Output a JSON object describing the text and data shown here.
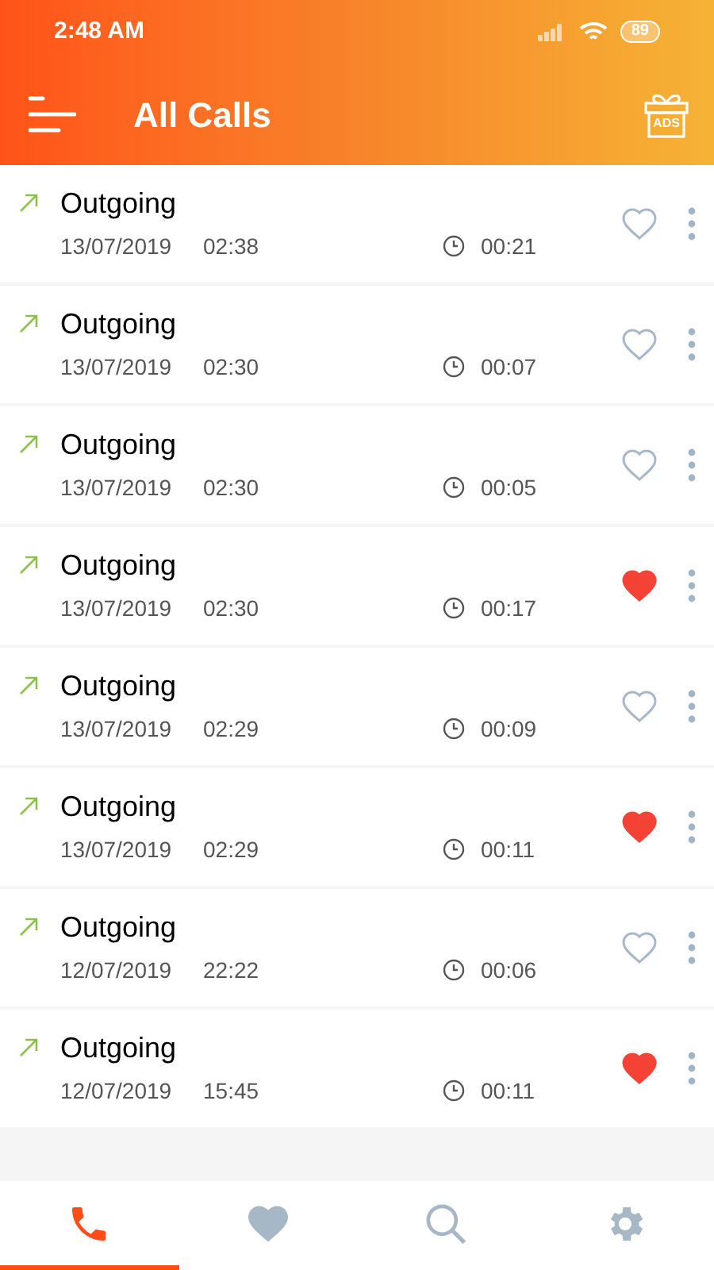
{
  "status_bar": {
    "time": "2:48 AM",
    "battery": "89"
  },
  "app_bar": {
    "title": "All Calls",
    "ads_label": "ADS"
  },
  "calls": [
    {
      "kind": "outgoing",
      "label": "Outgoing",
      "date": "13/07/2019",
      "time": "02:38",
      "duration": "00:21",
      "favorite": false
    },
    {
      "kind": "outgoing",
      "label": "Outgoing",
      "date": "13/07/2019",
      "time": "02:30",
      "duration": "00:07",
      "favorite": false
    },
    {
      "kind": "outgoing",
      "label": "Outgoing",
      "date": "13/07/2019",
      "time": "02:30",
      "duration": "00:05",
      "favorite": false
    },
    {
      "kind": "outgoing",
      "label": "Outgoing",
      "date": "13/07/2019",
      "time": "02:30",
      "duration": "00:17",
      "favorite": true
    },
    {
      "kind": "outgoing",
      "label": "Outgoing",
      "date": "13/07/2019",
      "time": "02:29",
      "duration": "00:09",
      "favorite": false
    },
    {
      "kind": "outgoing",
      "label": "Outgoing",
      "date": "13/07/2019",
      "time": "02:29",
      "duration": "00:11",
      "favorite": true
    },
    {
      "kind": "outgoing",
      "label": "Outgoing",
      "date": "12/07/2019",
      "time": "22:22",
      "duration": "00:06",
      "favorite": false
    },
    {
      "kind": "outgoing",
      "label": "Outgoing",
      "date": "12/07/2019",
      "time": "15:45",
      "duration": "00:11",
      "favorite": true
    }
  ],
  "bottom_tabs": [
    {
      "kind": "calls",
      "selected": true
    },
    {
      "kind": "favorites",
      "selected": false
    },
    {
      "kind": "search",
      "selected": false
    },
    {
      "kind": "settings",
      "selected": false
    }
  ]
}
